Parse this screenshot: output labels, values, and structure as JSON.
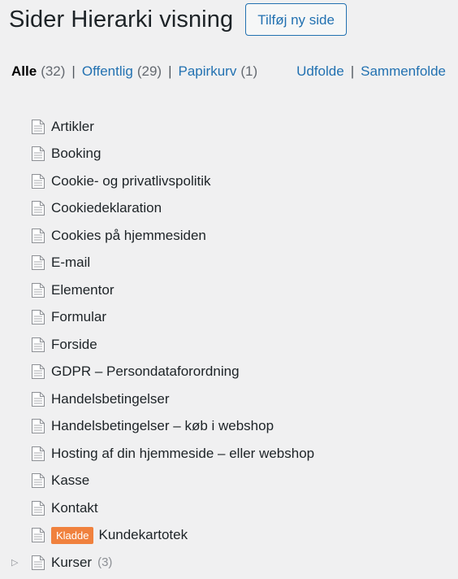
{
  "header": {
    "title": "Sider Hierarki visning",
    "add_button": "Tilføj ny side"
  },
  "filters": {
    "all": {
      "label": "Alle",
      "count": "(32)"
    },
    "public": {
      "label": "Offentlig",
      "count": "(29)"
    },
    "trash": {
      "label": "Papirkurv",
      "count": "(1)"
    },
    "sep": "|",
    "expand": "Udfolde",
    "collapse": "Sammenfolde"
  },
  "pages": [
    {
      "title": "Artikler"
    },
    {
      "title": "Booking"
    },
    {
      "title": "Cookie- og privatlivspolitik"
    },
    {
      "title": "Cookiedeklaration"
    },
    {
      "title": "Cookies på hjemmesiden"
    },
    {
      "title": "E-mail"
    },
    {
      "title": "Elementor"
    },
    {
      "title": "Formular"
    },
    {
      "title": "Forside"
    },
    {
      "title": "GDPR – Persondataforordning"
    },
    {
      "title": "Handelsbetingelser"
    },
    {
      "title": "Handelsbetingelser – køb i webshop"
    },
    {
      "title": "Hosting af din hjemmeside – eller webshop"
    },
    {
      "title": "Kasse"
    },
    {
      "title": "Kontakt"
    },
    {
      "title": "Kundekartotek",
      "badge": "Kladde"
    },
    {
      "title": "Kurser",
      "count": "(3)"
    }
  ],
  "icons": {
    "page": "page-icon",
    "expand": "expand-arrow-icon"
  },
  "colors": {
    "link": "#2271b1",
    "badge": "#f0813e",
    "background": "#f0f0f1"
  }
}
